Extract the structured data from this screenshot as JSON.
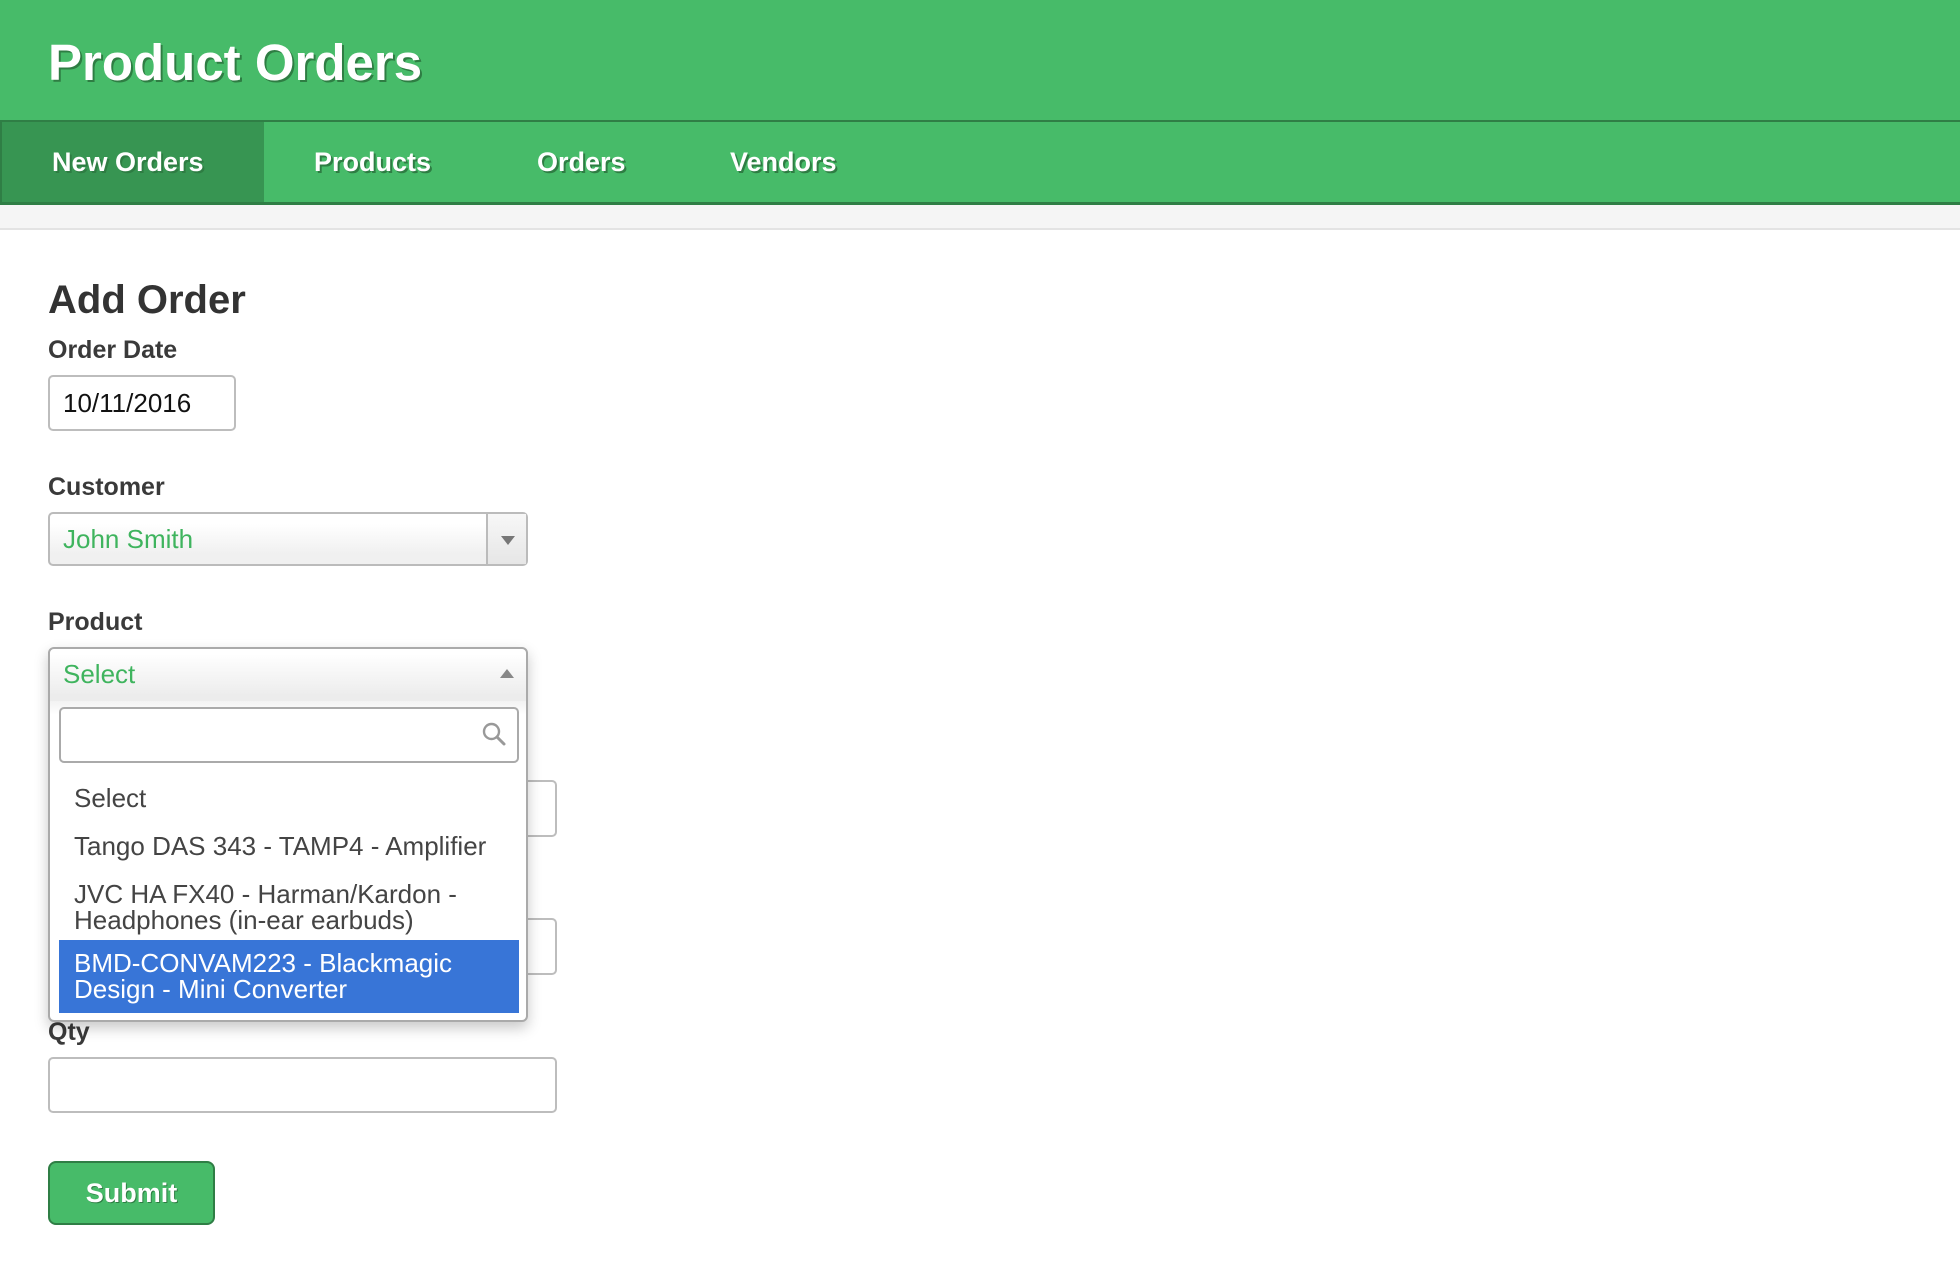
{
  "app": {
    "title": "Product Orders"
  },
  "nav": {
    "items": [
      {
        "label": "New Orders",
        "active": true
      },
      {
        "label": "Products",
        "active": false
      },
      {
        "label": "Orders",
        "active": false
      },
      {
        "label": "Vendors",
        "active": false
      }
    ]
  },
  "form": {
    "heading": "Add Order",
    "order_date": {
      "label": "Order Date",
      "value": "10/11/2016"
    },
    "customer": {
      "label": "Customer",
      "value": "John Smith",
      "icon": "chevron-down-icon"
    },
    "product": {
      "label": "Product",
      "value": "Select",
      "open": true,
      "icon": "chevron-up-icon",
      "search": {
        "value": "",
        "placeholder": "",
        "icon": "search-icon"
      },
      "options": [
        {
          "label": "Select",
          "highlighted": false
        },
        {
          "label": "Tango DAS 343 - TAMP4 - Amplifier",
          "highlighted": false
        },
        {
          "label": "JVC HA FX40 - Harman/Kardon - Headphones (in-ear earbuds)",
          "highlighted": false
        },
        {
          "label": "BMD-CONVAM223 - Blackmagic Design - Mini Converter",
          "highlighted": true
        }
      ]
    },
    "qty": {
      "label": "Qty",
      "value": ""
    },
    "submit_label": "Submit"
  },
  "colors": {
    "brand_green": "#47bb69",
    "nav_active": "#379552",
    "border_dark_green": "#2f7e45",
    "select_text_green": "#3fb45e",
    "highlight_blue": "#3875d7"
  }
}
